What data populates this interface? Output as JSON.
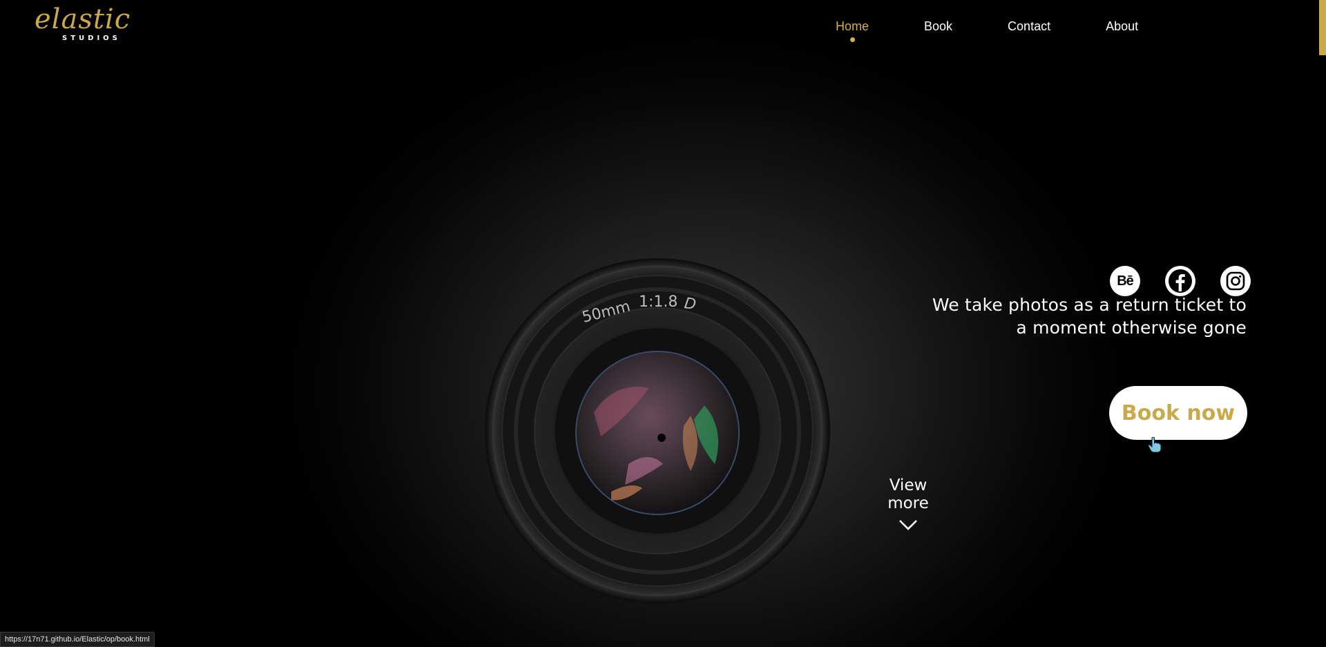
{
  "brand": {
    "logo_script": "elastic",
    "logo_subtitle": "STUDIOS"
  },
  "nav": {
    "items": [
      {
        "label": "Home",
        "active": true
      },
      {
        "label": "Book",
        "active": false
      },
      {
        "label": "Contact",
        "active": false
      },
      {
        "label": "About",
        "active": false
      }
    ]
  },
  "lens": {
    "engraving_focal": "50mm",
    "engraving_aperture": "1:1.8",
    "engraving_mark": "D"
  },
  "social": {
    "behance_label": "Bē",
    "icons": [
      "behance-icon",
      "facebook-icon",
      "instagram-icon"
    ]
  },
  "hero": {
    "tagline_line1": "We take photos as a return ticket to",
    "tagline_line2": "a moment otherwise gone",
    "book_button": "Book now",
    "view_more": "View more"
  },
  "status_bar": {
    "url": "https://17n71.github.io/Elastic/op/book.html"
  },
  "colors": {
    "accent": "#c9a94a",
    "nav_active": "#d4b04c",
    "background": "#000000",
    "text": "#ffffff"
  }
}
